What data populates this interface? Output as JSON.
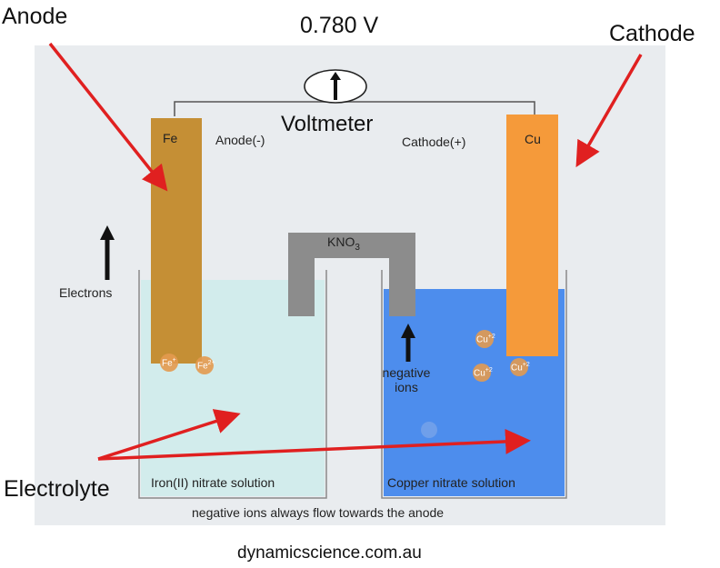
{
  "voltage": "0.780 V",
  "labels": {
    "anode": "Anode",
    "cathode": "Cathode",
    "electrolyte": "Electrolyte",
    "voltmeter": "Voltmeter",
    "anode_sign": "Anode(-)",
    "cathode_sign": "Cathode(+)",
    "fe": "Fe",
    "cu": "Cu",
    "salt_bridge": "KNO",
    "salt_bridge_sub": "3",
    "electrons": "Electrons",
    "negative_ions_line1": "negative",
    "negative_ions_line2": "ions",
    "left_solution": "Iron(II) nitrate solution",
    "right_solution": "Copper nitrate solution",
    "footer_note": "negative ions always flow towards the anode",
    "source": "dynamicscience.com.au"
  },
  "ions": {
    "fe_ion": "Fe",
    "fe_ion_charge": "+",
    "fe_ion2_charge": "2+",
    "cu_ion": "Cu",
    "cu_ion_charge": "+2"
  },
  "colors": {
    "panel": "#e9ecef",
    "fe_electrode": "#c58f35",
    "cu_electrode": "#f59a3a",
    "left_solution": "#d2ecec",
    "right_solution": "#4d8ded",
    "salt_bridge": "#8c8c8c",
    "pointer_arrow": "#e02020",
    "ion": "#e39a4f"
  }
}
